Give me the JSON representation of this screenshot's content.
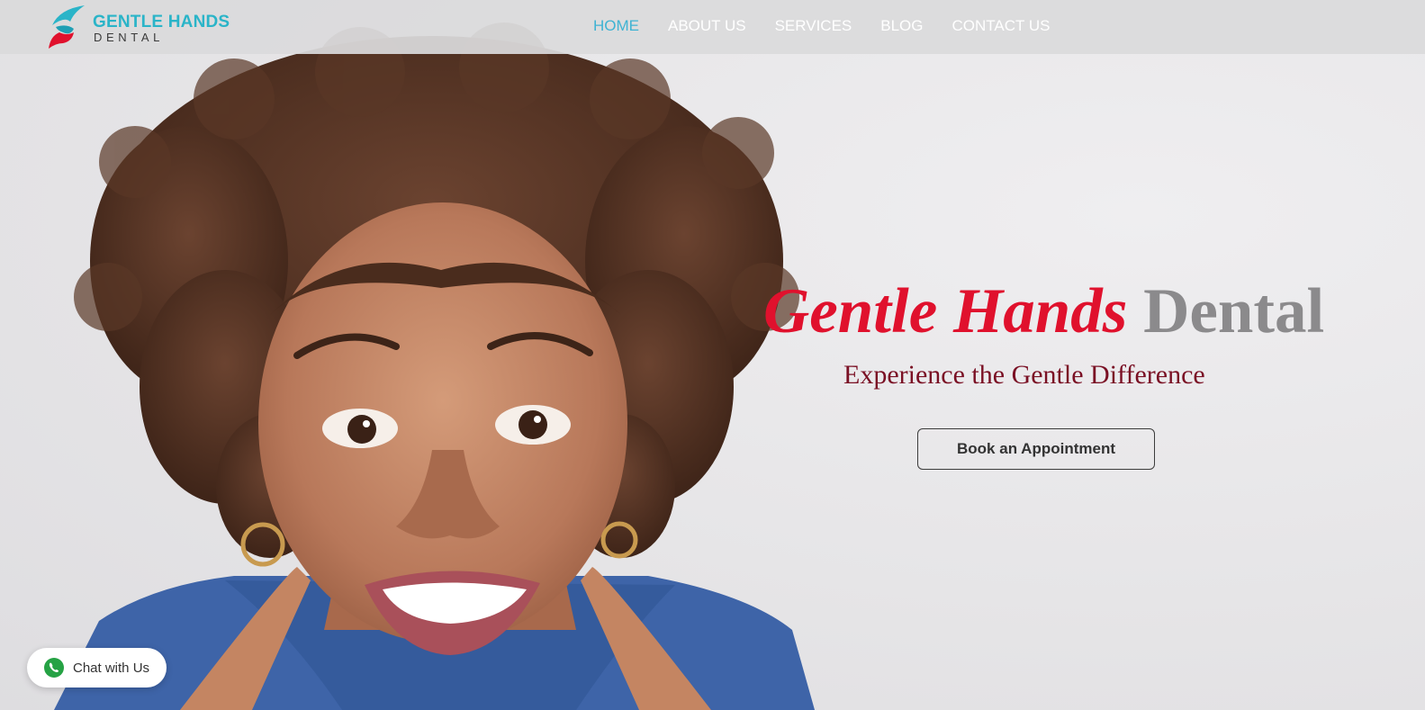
{
  "brand": {
    "line1": "GENTLE HANDS",
    "line2": "DENTAL",
    "logo_icon": "tooth-swoosh-logo-icon",
    "colors": {
      "teal": "#2ab4c8",
      "red": "#e0112d"
    }
  },
  "nav": {
    "items": [
      {
        "label": "HOME",
        "active": true
      },
      {
        "label": "ABOUT US"
      },
      {
        "label": "SERVICES"
      },
      {
        "label": "BLOG"
      },
      {
        "label": "CONTACT US"
      }
    ],
    "active_color": "#3fb3d3",
    "color": "#ffffff"
  },
  "hero": {
    "title_part1": "Gentle Hands",
    "title_part2": "Dental",
    "subtitle": "Experience the Gentle Difference",
    "cta_label": "Book an Appointment",
    "colors": {
      "title_red": "#e0112d",
      "title_gray": "#8b8a8c",
      "subtitle": "#7a1024"
    }
  },
  "chat": {
    "label": "Chat with Us",
    "icon": "whatsapp-icon",
    "icon_color": "#25a244"
  }
}
